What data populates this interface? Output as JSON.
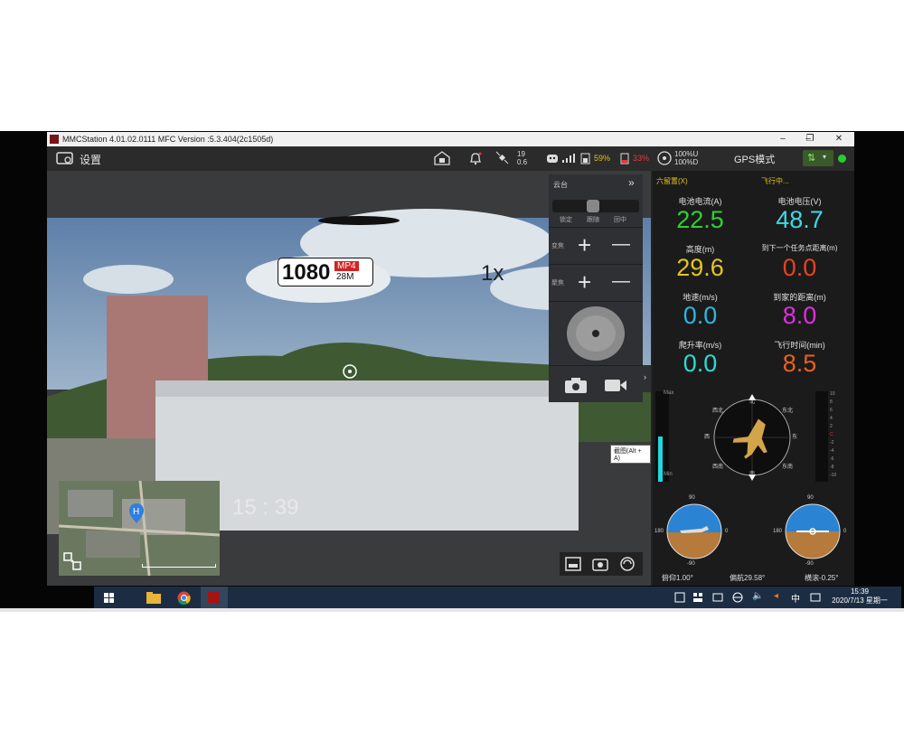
{
  "window": {
    "title": "MMCStation 4.01.02.0111 MFC Version :5.3.404(2c1505d)",
    "min": "–",
    "max": "❐",
    "close": "✕"
  },
  "toolbar": {
    "settings_label": "设置",
    "satellites": "19",
    "hdop": "0.6",
    "signal_pct": "59%",
    "battery_pct": "33%",
    "link_up": "100%U",
    "link_down": "100%D",
    "mode": "GPS模式"
  },
  "video": {
    "resolution": "1080",
    "format": "MP4",
    "bitrate": "28M",
    "zoom": "1x",
    "timer": "15 : 39"
  },
  "gimbal": {
    "title": "云台",
    "collapse": "»",
    "modes": [
      "锁定",
      "跟随",
      "回中"
    ],
    "zoom_label": "变焦",
    "focus_label": "聚焦",
    "plus": "+",
    "minus": "—"
  },
  "tooltip": "截图(Alt + A)",
  "telemetry": {
    "status_left": "六留置(X)",
    "status_right": "飞行中...",
    "items": [
      {
        "label": "电池电流(A)",
        "value": "22.5",
        "color": "#2fd12f"
      },
      {
        "label": "电池电压(V)",
        "value": "48.7",
        "color": "#3fd9e6"
      },
      {
        "label": "高度(m)",
        "value": "29.6",
        "color": "#e7c41f"
      },
      {
        "label": "到下一个任务点距离(m)",
        "value": "0.0",
        "color": "#e8421e"
      },
      {
        "label": "地速(m/s)",
        "value": "0.0",
        "color": "#2bb7e0"
      },
      {
        "label": "到家的距离(m)",
        "value": "8.0",
        "color": "#e02ee0"
      },
      {
        "label": "爬升率(m/s)",
        "value": "0.0",
        "color": "#2fd9d0"
      },
      {
        "label": "飞行时间(min)",
        "value": "8.5",
        "color": "#e8601e"
      }
    ]
  },
  "gauges": {
    "left_max": "Max",
    "left_min": "Min",
    "compass_n": "北",
    "compass_s": "南",
    "compass_e": "东",
    "compass_w": "西",
    "compass_nw": "西北",
    "compass_ne": "东北",
    "compass_sw": "西南",
    "compass_se": "东南",
    "att_90": "90",
    "att_180": "180",
    "att_0": "0",
    "att_m90": "-90",
    "pitch": "俯仰1.00°",
    "heading": "偏航29.58°",
    "roll": "横滚-0.25°",
    "scale_right": [
      "10",
      "8",
      "6",
      "4",
      "2",
      "C",
      "-2",
      "-4",
      "-6",
      "-8",
      "-10"
    ]
  },
  "taskbar": {
    "ime": "中",
    "time": "15:39",
    "date": "2020/7/13 星期一"
  }
}
